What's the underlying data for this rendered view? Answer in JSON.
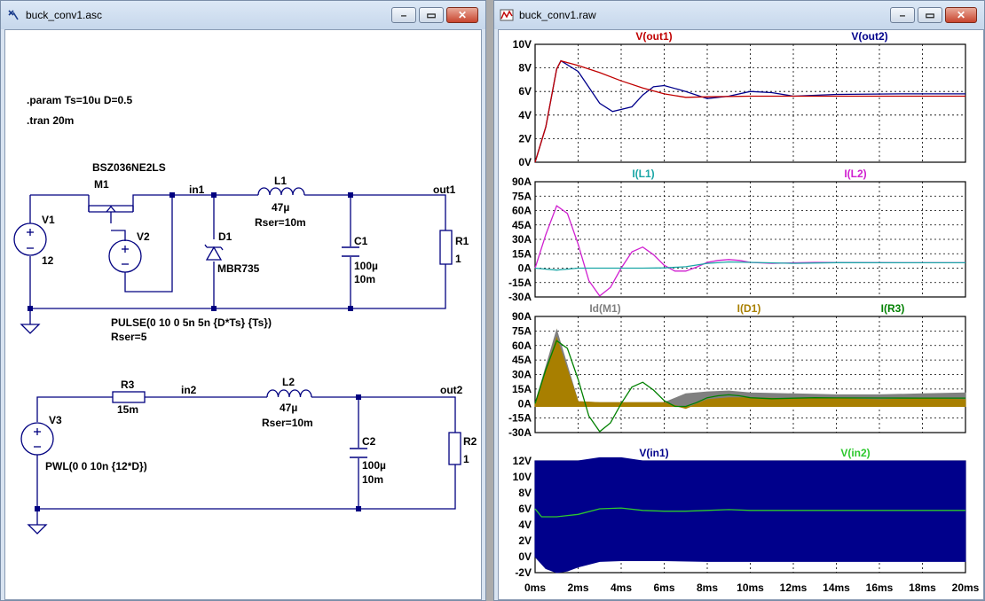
{
  "schematic_window": {
    "title": "buck_conv1.asc",
    "directives": [
      ".param Ts=10u D=0.5",
      ".tran 20m"
    ],
    "labels": {
      "m1_model": "BSZ036NE2LS",
      "m1_name": "M1",
      "v1_name": "V1",
      "v1_value": "12",
      "v2_name": "V2",
      "d1_name": "D1",
      "d1_model": "MBR735",
      "l1_name": "L1",
      "l1_value": "47µ",
      "l1_rser": "Rser=10m",
      "c1_name": "C1",
      "c1_value": "100µ",
      "c1_esr": "10m",
      "r1_name": "R1",
      "r1_value": "1",
      "net_in1": "in1",
      "net_out1": "out1",
      "v2_source": "PULSE(0 10 0 5n 5n {D*Ts} {Ts})",
      "v2_rser": "Rser=5",
      "r3_name": "R3",
      "r3_value": "15m",
      "net_in2": "in2",
      "l2_name": "L2",
      "l2_value": "47µ",
      "l2_rser": "Rser=10m",
      "net_out2": "out2",
      "v3_name": "V3",
      "v3_source": "PWL(0 0 10n {12*D})",
      "c2_name": "C2",
      "c2_value": "100µ",
      "c2_esr": "10m",
      "r2_name": "R2",
      "r2_value": "1"
    }
  },
  "waveform_window": {
    "title": "buck_conv1.raw",
    "x_ticks": [
      "0ms",
      "2ms",
      "4ms",
      "6ms",
      "8ms",
      "10ms",
      "12ms",
      "14ms",
      "16ms",
      "18ms",
      "20ms"
    ]
  },
  "colors": {
    "wire": "#000080",
    "v_out1": "#c00000",
    "v_out2": "#00008b",
    "i_l1": "#1aa6a6",
    "i_l2": "#d020d0",
    "id_m1": "#808080",
    "i_d1": "#a87f00",
    "i_r3": "#008000",
    "v_in1": "#00008b",
    "v_in2": "#2ec82e"
  },
  "chart_data": [
    {
      "type": "line",
      "series": [
        {
          "name": "V(out1)",
          "x": [
            0,
            0.5,
            1,
            1.2,
            2,
            3,
            4,
            5,
            6,
            7,
            8,
            10,
            14,
            20
          ],
          "values": [
            0,
            3,
            7.9,
            8.6,
            8.2,
            7.6,
            6.9,
            6.3,
            5.8,
            5.5,
            5.55,
            5.6,
            5.6,
            5.6
          ]
        },
        {
          "name": "V(out2)",
          "x": [
            0,
            0.5,
            1,
            1.2,
            2,
            3,
            3.6,
            4.5,
            5,
            5.5,
            6,
            7,
            8,
            9,
            10,
            11,
            12,
            14,
            17,
            20
          ],
          "values": [
            0,
            3,
            7.9,
            8.6,
            7.7,
            5.0,
            4.3,
            4.7,
            5.7,
            6.4,
            6.5,
            6.0,
            5.4,
            5.6,
            6.0,
            5.9,
            5.6,
            5.75,
            5.8,
            5.8
          ]
        }
      ],
      "ylim": [
        0,
        10
      ],
      "yticks": [
        "10V",
        "8V",
        "6V",
        "4V",
        "2V",
        "0V"
      ]
    },
    {
      "type": "line",
      "series": [
        {
          "name": "I(L1)",
          "x": [
            0,
            0.5,
            1,
            1.5,
            2,
            3,
            5,
            6,
            7,
            8,
            9,
            10,
            12,
            14,
            17,
            20
          ],
          "values": [
            0,
            -1,
            -2,
            -1,
            0,
            0,
            0,
            0.3,
            1.5,
            5,
            6.5,
            6,
            5,
            5.7,
            5.6,
            5.6
          ]
        },
        {
          "name": "I(L2)",
          "x": [
            0,
            0.5,
            1,
            1.5,
            2,
            2.5,
            3,
            3.5,
            4,
            4.5,
            5,
            5.5,
            6,
            6.5,
            7,
            7.5,
            8,
            8.5,
            9,
            9.5,
            10,
            11,
            12,
            13,
            14,
            16,
            18,
            20
          ],
          "values": [
            0,
            35,
            65,
            57,
            25,
            -13,
            -29,
            -20,
            0,
            17,
            22,
            14,
            3,
            -3,
            -3,
            1,
            6,
            8,
            9,
            8,
            6,
            5,
            5.5,
            6,
            5.8,
            5.7,
            5.6,
            5.6
          ]
        }
      ],
      "ylim": [
        -30,
        90
      ],
      "yticks": [
        "90A",
        "75A",
        "60A",
        "45A",
        "30A",
        "15A",
        "0A",
        "-15A",
        "-30A"
      ]
    },
    {
      "type": "area",
      "series": [
        {
          "name": "Id(M1)",
          "x": [
            0,
            1,
            2,
            3,
            4,
            5,
            6,
            7,
            8,
            9,
            10,
            12,
            14,
            16,
            18,
            20
          ],
          "values": [
            0,
            76,
            2,
            1,
            1,
            1,
            1,
            10,
            12,
            13,
            11,
            10,
            9,
            9,
            10,
            11
          ]
        },
        {
          "name": "I(D1)",
          "x": [
            0,
            1,
            2,
            3,
            4,
            5,
            6,
            7,
            8,
            9,
            10,
            12,
            14,
            16,
            18,
            20
          ],
          "values": [
            0,
            68,
            2,
            1,
            1,
            1,
            1,
            -5,
            4,
            6,
            6,
            5,
            5,
            4,
            5,
            4
          ]
        },
        {
          "name": "I(R3)",
          "x": [
            0,
            0.5,
            1,
            1.5,
            2,
            2.5,
            3,
            3.5,
            4,
            4.5,
            5,
            5.5,
            6,
            6.5,
            7,
            7.5,
            8,
            8.5,
            9,
            9.5,
            10,
            11,
            12,
            13,
            14,
            16,
            18,
            20
          ],
          "values": [
            0,
            35,
            65,
            57,
            25,
            -13,
            -29,
            -20,
            0,
            17,
            22,
            14,
            3,
            -3,
            -3,
            1,
            6,
            8,
            9,
            8,
            6,
            5,
            5.5,
            6,
            5.8,
            5.7,
            5.6,
            5.6
          ]
        }
      ],
      "ylim": [
        -30,
        90
      ],
      "yticks": [
        "90A",
        "75A",
        "60A",
        "45A",
        "30A",
        "15A",
        "0A",
        "-15A",
        "-30A"
      ]
    },
    {
      "type": "area",
      "series": [
        {
          "name": "V(in1)",
          "x": [
            0,
            0.5,
            1,
            1.5,
            2,
            3,
            4,
            5,
            6,
            8,
            10,
            14,
            20
          ],
          "low": [
            0,
            -1.5,
            -2,
            -1.8,
            -1.3,
            -0.6,
            -0.5,
            -0.5,
            -0.5,
            -0.6,
            -0.6,
            -0.6,
            -0.6
          ],
          "high": [
            12,
            12,
            12,
            12,
            12,
            12.4,
            12.4,
            12,
            12,
            12,
            12,
            12,
            12
          ]
        },
        {
          "name": "V(in2)",
          "x": [
            0,
            0.3,
            1,
            2,
            3,
            4,
            5,
            6,
            7,
            8,
            9,
            10,
            12,
            14,
            17,
            20
          ],
          "values": [
            6,
            5,
            5,
            5.3,
            6,
            6.1,
            5.8,
            5.7,
            5.7,
            5.8,
            5.9,
            5.8,
            5.8,
            5.8,
            5.8,
            5.8
          ]
        }
      ],
      "ylim": [
        -2,
        12
      ],
      "yticks": [
        "12V",
        "10V",
        "8V",
        "6V",
        "4V",
        "2V",
        "0V",
        "-2V"
      ]
    }
  ]
}
